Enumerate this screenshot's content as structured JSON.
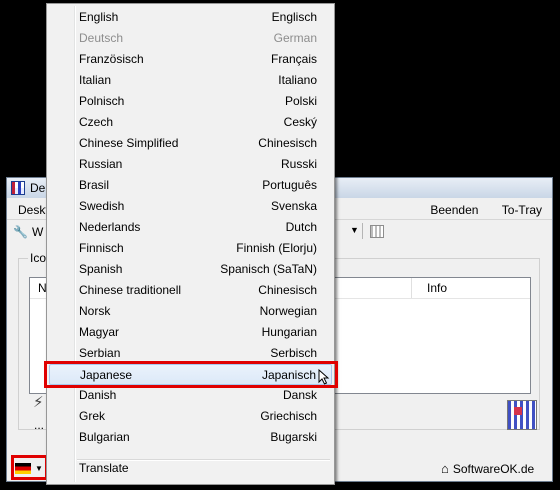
{
  "app": {
    "title": "De",
    "menu_left": "Deskt",
    "menu_right": [
      "Beenden",
      "To-Tray"
    ],
    "toolbar_text": "W",
    "group_label": "Ico",
    "list_col_first": "N",
    "list_col_info": "Info",
    "more": "...",
    "footer_link": "SoftwareOK.de"
  },
  "language_menu": {
    "items": [
      {
        "label": "English",
        "translation": "Englisch",
        "state": "normal"
      },
      {
        "label": "Deutsch",
        "translation": "German",
        "state": "disabled"
      },
      {
        "label": "Französisch",
        "translation": "Français",
        "state": "normal"
      },
      {
        "label": "Italian",
        "translation": "Italiano",
        "state": "normal"
      },
      {
        "label": "Polnisch",
        "translation": "Polski",
        "state": "normal"
      },
      {
        "label": "Czech",
        "translation": "Ceský",
        "state": "normal"
      },
      {
        "label": "Chinese Simplified",
        "translation": "Chinesisch",
        "state": "normal"
      },
      {
        "label": "Russian",
        "translation": "Russki",
        "state": "normal"
      },
      {
        "label": "Brasil",
        "translation": "Português",
        "state": "normal"
      },
      {
        "label": "Swedish",
        "translation": "Svenska",
        "state": "normal"
      },
      {
        "label": "Nederlands",
        "translation": "Dutch",
        "state": "normal"
      },
      {
        "label": "Finnisch",
        "translation": "Finnish (Elorju)",
        "state": "normal"
      },
      {
        "label": "Spanish",
        "translation": "Spanisch (SaTaN)",
        "state": "normal"
      },
      {
        "label": "Chinese traditionell",
        "translation": "Chinesisch",
        "state": "normal"
      },
      {
        "label": "Norsk",
        "translation": "Norwegian",
        "state": "normal"
      },
      {
        "label": "Magyar",
        "translation": "Hungarian",
        "state": "normal"
      },
      {
        "label": "Serbian",
        "translation": "Serbisch",
        "state": "normal"
      },
      {
        "label": "Japanese",
        "translation": "Japanisch",
        "state": "highlighted"
      },
      {
        "label": "Danish",
        "translation": "Dansk",
        "state": "normal"
      },
      {
        "label": "Grek",
        "translation": "Griechisch",
        "state": "normal"
      },
      {
        "label": "Bulgarian",
        "translation": "Bugarski",
        "state": "normal"
      }
    ],
    "translate_label": "Translate"
  },
  "colors": {
    "annotation_red": "#e00000",
    "menu_bg": "#f1f1f1",
    "selection_border": "#a8c8ee"
  },
  "icons": {
    "language_flag": "german-flag-icon",
    "toolbar_tool": "wrench-icon",
    "footer_home": "home-icon",
    "bolt": "lightning-icon"
  }
}
